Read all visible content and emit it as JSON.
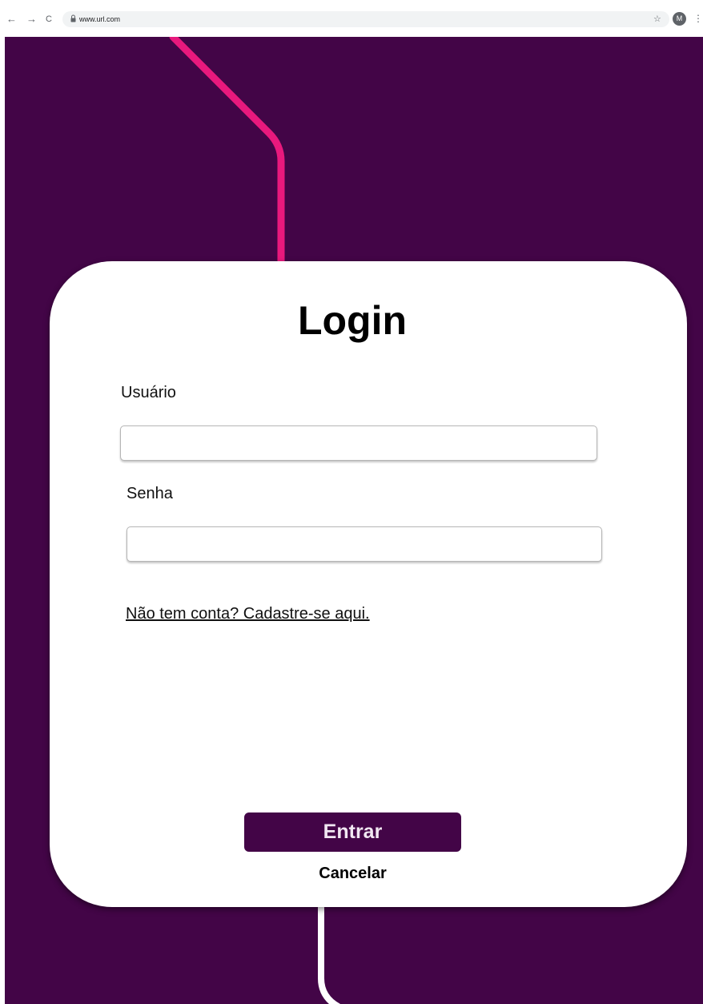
{
  "browser": {
    "back_icon": "←",
    "forward_icon": "→",
    "reload_icon": "C",
    "url": "www.url.com",
    "star_icon": "☆",
    "profile_initial": "M",
    "menu_icon": "⋮"
  },
  "login": {
    "title": "Login",
    "username_label": "Usuário",
    "username_value": "",
    "password_label": "Senha",
    "password_value": "",
    "signup_link": "Não tem conta? Cadastre-se aqui.",
    "enter_button": "Entrar",
    "cancel_button": "Cancelar"
  },
  "colors": {
    "background": "#430547",
    "accent_line": "#e8197d",
    "button": "#430547",
    "card": "#ffffff"
  }
}
